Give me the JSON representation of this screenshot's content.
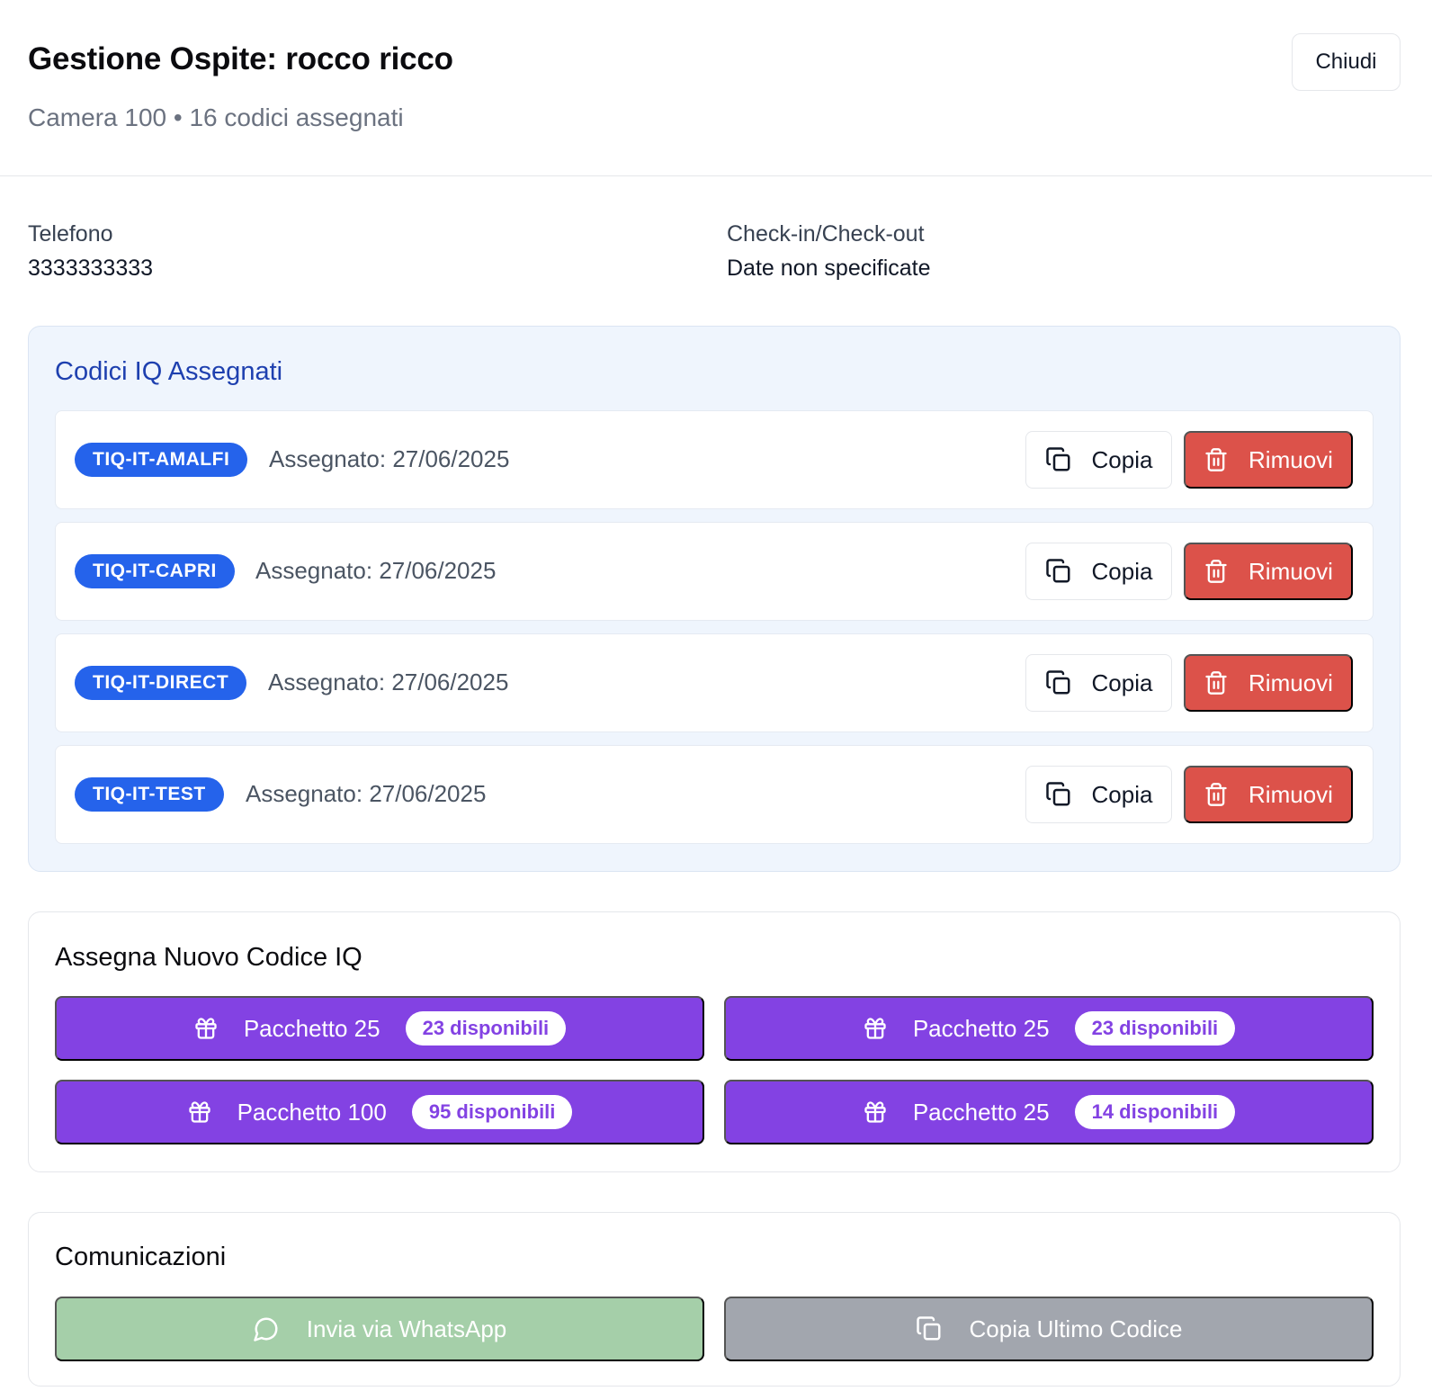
{
  "header": {
    "title": "Gestione Ospite: rocco ricco",
    "subtitle": "Camera 100 • 16 codici assegnati",
    "close_label": "Chiudi"
  },
  "info": {
    "phone_label": "Telefono",
    "phone_value": "3333333333",
    "dates_label": "Check-in/Check-out",
    "dates_value": "Date non specificate"
  },
  "codes": {
    "title": "Codici IQ Assegnati",
    "copy_label": "Copia",
    "remove_label": "Rimuovi",
    "items": [
      {
        "code": "TIQ-IT-AMALFI",
        "assigned": "Assegnato: 27/06/2025"
      },
      {
        "code": "TIQ-IT-CAPRI",
        "assigned": "Assegnato: 27/06/2025"
      },
      {
        "code": "TIQ-IT-DIRECT",
        "assigned": "Assegnato: 27/06/2025"
      },
      {
        "code": "TIQ-IT-TEST",
        "assigned": "Assegnato: 27/06/2025"
      }
    ]
  },
  "assign": {
    "title": "Assegna Nuovo Codice IQ",
    "packages": [
      {
        "label": "Pacchetto 25",
        "available": "23 disponibili"
      },
      {
        "label": "Pacchetto 25",
        "available": "23 disponibili"
      },
      {
        "label": "Pacchetto 100",
        "available": "95 disponibili"
      },
      {
        "label": "Pacchetto 25",
        "available": "14 disponibili"
      }
    ]
  },
  "comm": {
    "title": "Comunicazioni",
    "whatsapp_label": "Invia via WhatsApp",
    "copy_last_label": "Copia Ultimo Codice"
  },
  "colors": {
    "badge_blue": "#2563eb",
    "remove_red": "#dc524a",
    "package_purple": "#8342e3",
    "whatsapp_disabled": "#a5cfa9",
    "copy_disabled": "#a2a6ae"
  },
  "icons": {
    "copy": "copy-icon",
    "remove": "trash-icon",
    "package": "gift-icon",
    "whatsapp": "chat-bubble-icon"
  }
}
